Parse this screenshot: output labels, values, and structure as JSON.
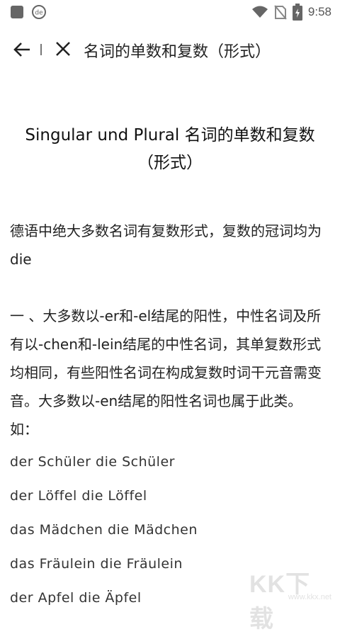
{
  "status": {
    "time": "9:58",
    "icons": [
      "app-icon",
      "de-icon",
      "wifi-icon",
      "no-sim-icon",
      "battery-icon"
    ]
  },
  "toolbar": {
    "title": "名词的单数和复数（形式）",
    "back_icon": "arrow-left-icon",
    "close_icon": "close-icon"
  },
  "article": {
    "title_line1": "Singular und Plural 名词的单数和复数",
    "title_line2": "（形式）",
    "intro": "德语中绝大多数名词有复数形式，复数的冠词均为die",
    "section1": "一 、大多数以-er和-el结尾的阳性，中性名词及所有以-chen和-lein结尾的中性名词，其单复数形式均相同，有些阳性名词在构成复数时词干元音需变音。大多数以-en结尾的阳性名词也属于此类。如：",
    "examples": [
      "der Schüler die Schüler",
      "der Löffel die Löffel",
      "das Mädchen die Mädchen",
      "das Fräulein die Fräulein",
      "der Apfel die Äpfel"
    ]
  },
  "watermark": {
    "logo_text": "KK下载",
    "url": "www.kkx.net"
  }
}
